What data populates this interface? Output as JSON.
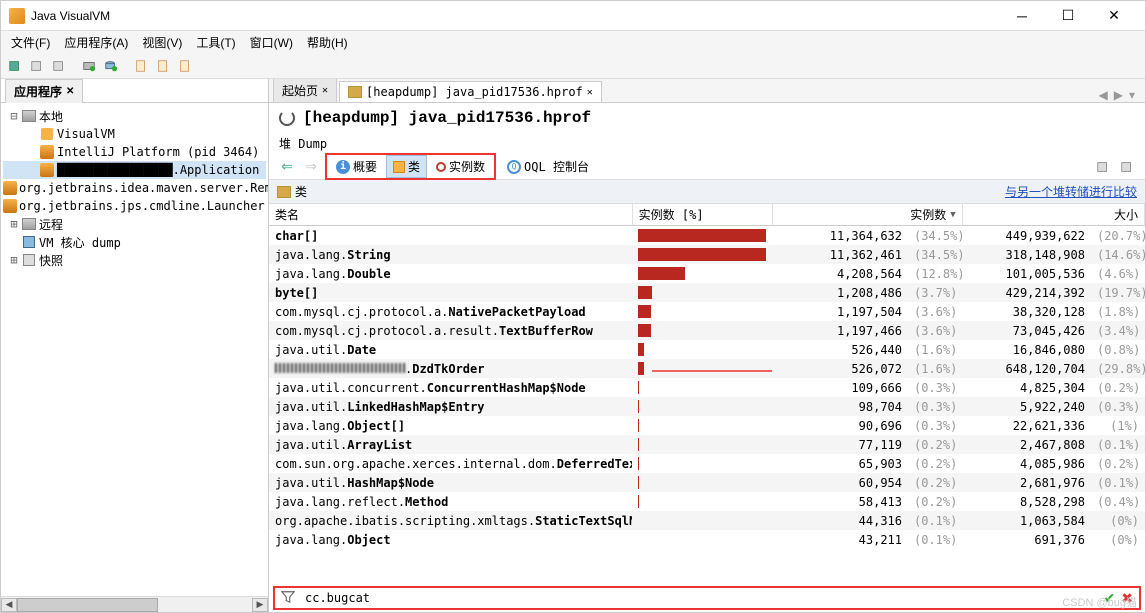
{
  "app": {
    "title": "Java VisualVM"
  },
  "menus": [
    "文件(F)",
    "应用程序(A)",
    "视图(V)",
    "工具(T)",
    "窗口(W)",
    "帮助(H)"
  ],
  "left_panel": {
    "tab": "应用程序",
    "tree": [
      {
        "indent": 0,
        "toggle": "⊟",
        "icon": "host",
        "label": "本地"
      },
      {
        "indent": 1,
        "toggle": "",
        "icon": "vm",
        "label": "VisualVM"
      },
      {
        "indent": 1,
        "toggle": "",
        "icon": "java",
        "label": "IntelliJ Platform (pid 3464)"
      },
      {
        "indent": 1,
        "toggle": "",
        "icon": "java",
        "label": "████████████████.Application",
        "selected": true
      },
      {
        "indent": 1,
        "toggle": "",
        "icon": "java",
        "label": "org.jetbrains.idea.maven.server.RemoteMavenServer"
      },
      {
        "indent": 1,
        "toggle": "",
        "icon": "java",
        "label": "org.jetbrains.jps.cmdline.Launcher"
      },
      {
        "indent": 0,
        "toggle": "⊞",
        "icon": "host",
        "label": "远程"
      },
      {
        "indent": 0,
        "toggle": "",
        "icon": "db",
        "label": "VM 核心 dump"
      },
      {
        "indent": 0,
        "toggle": "⊞",
        "icon": "snap",
        "label": "快照"
      }
    ]
  },
  "tabs": {
    "start": "起始页",
    "dump": "[heapdump] java_pid17536.hprof"
  },
  "header": {
    "title": "[heapdump] java_pid17536.hprof",
    "sub": "堆 Dump"
  },
  "view_buttons": {
    "overview": "概要",
    "classes": "类",
    "instances": "实例数",
    "oql": "OQL 控制台"
  },
  "section": {
    "label": "类",
    "compare": "与另一个堆转储进行比较"
  },
  "columns": {
    "name": "类名",
    "barhdr": "实例数 [%]",
    "inst": "实例数",
    "size": "大小"
  },
  "rows": [
    {
      "pkg": "",
      "cls": "char[]",
      "bar": 100,
      "inst": "11,364,632",
      "pct1": "(34.5%)",
      "size": "449,939,622",
      "pct2": "(20.7%)"
    },
    {
      "pkg": "java.lang.",
      "cls": "String",
      "bar": 100,
      "inst": "11,362,461",
      "pct1": "(34.5%)",
      "size": "318,148,908",
      "pct2": "(14.6%)"
    },
    {
      "pkg": "java.lang.",
      "cls": "Double",
      "bar": 37,
      "inst": "4,208,564",
      "pct1": "(12.8%)",
      "size": "101,005,536",
      "pct2": "(4.6%)"
    },
    {
      "pkg": "",
      "cls": "byte[]",
      "bar": 11,
      "inst": "1,208,486",
      "pct1": "(3.7%)",
      "size": "429,214,392",
      "pct2": "(19.7%)"
    },
    {
      "pkg": "com.mysql.cj.protocol.a.",
      "cls": "NativePacketPayload",
      "bar": 10,
      "inst": "1,197,504",
      "pct1": "(3.6%)",
      "size": "38,320,128",
      "pct2": "(1.8%)"
    },
    {
      "pkg": "com.mysql.cj.protocol.a.result.",
      "cls": "TextBufferRow",
      "bar": 10,
      "inst": "1,197,466",
      "pct1": "(3.6%)",
      "size": "73,045,426",
      "pct2": "(3.4%)"
    },
    {
      "pkg": "java.util.",
      "cls": "Date",
      "bar": 5,
      "inst": "526,440",
      "pct1": "(1.6%)",
      "size": "16,846,080",
      "pct2": "(0.8%)"
    },
    {
      "pkg": "██████████████.",
      "cls": "DzdTkOrder",
      "bar": 5,
      "inst": "526,072",
      "pct1": "(1.6%)",
      "size": "648,120,704",
      "pct2": "(29.8%)",
      "arrow": true,
      "pixelpkg": true
    },
    {
      "pkg": "java.util.concurrent.",
      "cls": "ConcurrentHashMap$Node",
      "bar": 1,
      "inst": "109,666",
      "pct1": "(0.3%)",
      "size": "4,825,304",
      "pct2": "(0.2%)"
    },
    {
      "pkg": "java.util.",
      "cls": "LinkedHashMap$Entry",
      "bar": 1,
      "inst": "98,704",
      "pct1": "(0.3%)",
      "size": "5,922,240",
      "pct2": "(0.3%)"
    },
    {
      "pkg": "java.lang.",
      "cls": "Object[]",
      "bar": 1,
      "inst": "90,696",
      "pct1": "(0.3%)",
      "size": "22,621,336",
      "pct2": "(1%)"
    },
    {
      "pkg": "java.util.",
      "cls": "ArrayList",
      "bar": 1,
      "inst": "77,119",
      "pct1": "(0.2%)",
      "size": "2,467,808",
      "pct2": "(0.1%)"
    },
    {
      "pkg": "com.sun.org.apache.xerces.internal.dom.",
      "cls": "DeferredTextImpl",
      "bar": 1,
      "inst": "65,903",
      "pct1": "(0.2%)",
      "size": "4,085,986",
      "pct2": "(0.2%)"
    },
    {
      "pkg": "java.util.",
      "cls": "HashMap$Node",
      "bar": 1,
      "inst": "60,954",
      "pct1": "(0.2%)",
      "size": "2,681,976",
      "pct2": "(0.1%)"
    },
    {
      "pkg": "java.lang.reflect.",
      "cls": "Method",
      "bar": 1,
      "inst": "58,413",
      "pct1": "(0.2%)",
      "size": "8,528,298",
      "pct2": "(0.4%)"
    },
    {
      "pkg": "org.apache.ibatis.scripting.xmltags.",
      "cls": "StaticTextSqlNode",
      "bar": 0,
      "inst": "44,316",
      "pct1": "(0.1%)",
      "size": "1,063,584",
      "pct2": "(0%)"
    },
    {
      "pkg": "java.lang.",
      "cls": "Object",
      "bar": 0,
      "inst": "43,211",
      "pct1": "(0.1%)",
      "size": "691,376",
      "pct2": "(0%)"
    }
  ],
  "filter": {
    "value": "cc.bugcat"
  },
  "watermark": "CSDN @bug猫"
}
